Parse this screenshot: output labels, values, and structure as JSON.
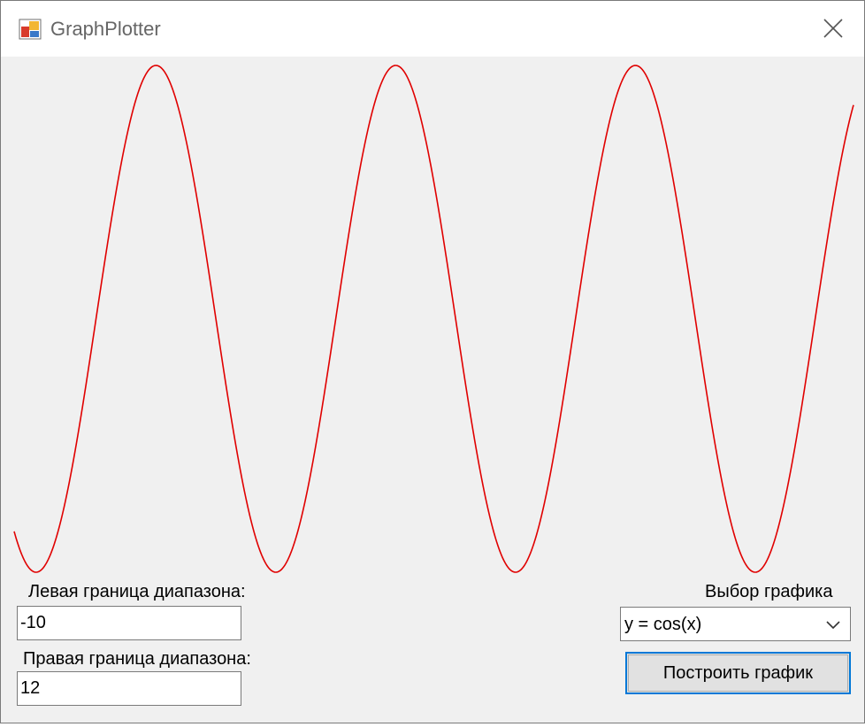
{
  "window": {
    "title": "GraphPlotter"
  },
  "form": {
    "left_label": "Левая граница диапазона:",
    "left_value": "-10",
    "right_label": "Правая граница диапазона:",
    "right_value": "12",
    "graph_select_label": "Выбор графика",
    "graph_select_value": "y = cos(x)",
    "plot_button_label": "Построить график"
  },
  "colors": {
    "curve": "#e00000",
    "button_focus": "#0078d7"
  },
  "chart_data": {
    "type": "line",
    "function": "cos",
    "x_range": [
      -10,
      12
    ],
    "grid": false,
    "legend": "none"
  }
}
